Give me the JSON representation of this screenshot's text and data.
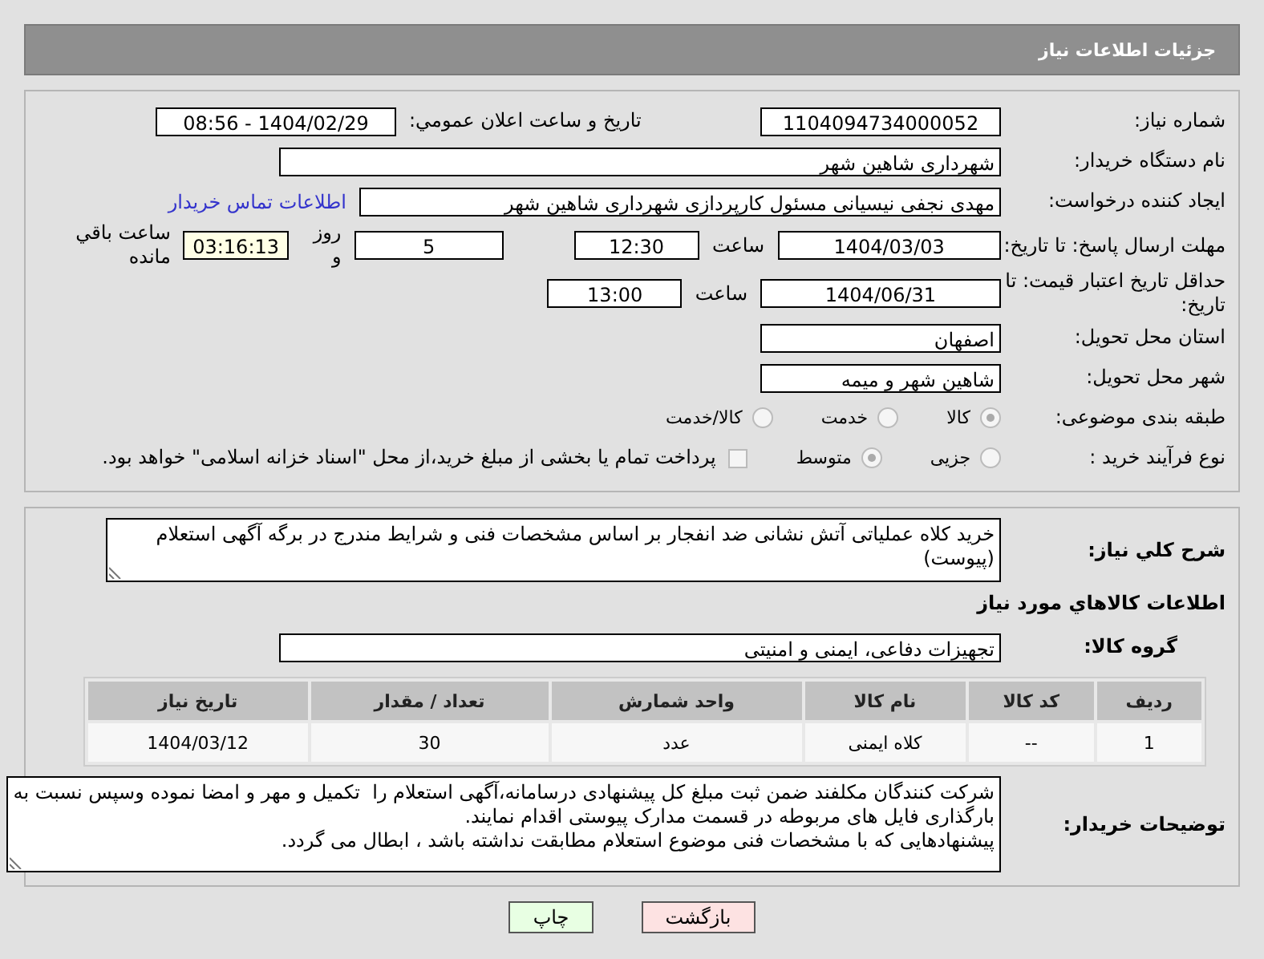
{
  "header": {
    "title": "جزئیات اطلاعات نیاز"
  },
  "need_number": {
    "label": "شماره نیاز:",
    "value": "1104094734000052"
  },
  "announce": {
    "label": "تاریخ و ساعت اعلان عمومي:",
    "value": "1404/02/29 - 08:56"
  },
  "buyer": {
    "label": "نام دستگاه خریدار:",
    "value": "شهرداری شاهین شهر"
  },
  "creator": {
    "label": "ایجاد کننده درخواست:",
    "value": "مهدی نجفی نیسیانی مسئول کارپردازی شهرداری شاهین شهر",
    "link": "اطلاعات تماس خریدار"
  },
  "deadline": {
    "label": "مهلت ارسال پاسخ: تا تاریخ:",
    "date": "1404/03/03",
    "time_label": "ساعت",
    "time": "12:30",
    "days": "5",
    "days_label": "روز و",
    "remaining": "03:16:13",
    "remaining_label": "ساعت باقي مانده"
  },
  "validity": {
    "label": "حداقل تاریخ اعتبار قیمت: تا تاریخ:",
    "date": "1404/06/31",
    "time_label": "ساعت",
    "time": "13:00"
  },
  "province": {
    "label": "استان محل تحویل:",
    "value": "اصفهان"
  },
  "city": {
    "label": "شهر محل تحویل:",
    "value": "شاهین شهر و میمه"
  },
  "category": {
    "label": "طبقه بندی موضوعی:",
    "options": [
      {
        "label": "کالا",
        "selected": true
      },
      {
        "label": "خدمت",
        "selected": false
      },
      {
        "label": "کالا/خدمت",
        "selected": false
      }
    ]
  },
  "process": {
    "label": "نوع فرآیند خرید :",
    "options": [
      {
        "label": "جزیی",
        "selected": false
      },
      {
        "label": "متوسط",
        "selected": true
      }
    ],
    "treasury": {
      "label": "پرداخت تمام یا بخشی از مبلغ خرید،از محل \"اسناد خزانه اسلامی\" خواهد بود.",
      "checked": false
    }
  },
  "description": {
    "label": "شرح کلي نیاز:",
    "value": "خرید کلاه عملیاتی آتش نشانی ضد انفجار بر اساس مشخصات فنی و شرایط مندرج در برگه آگهی استعلام (پیوست)"
  },
  "goods_heading": "اطلاعات کالاهاي مورد نیاز",
  "goods_group": {
    "label": "گروه کالا:",
    "value": "تجهیزات دفاعی، ایمنی و امنیتی"
  },
  "table": {
    "columns": [
      "ردیف",
      "کد کالا",
      "نام کالا",
      "واحد شمارش",
      "تعداد / مقدار",
      "تاریخ نیاز"
    ],
    "rows": [
      [
        "1",
        "--",
        "کلاه ایمنی",
        "عدد",
        "30",
        "1404/03/12"
      ]
    ]
  },
  "buyer_notes": {
    "label": "توضیحات خریدار:",
    "value": "شرکت کنندگان مکلفند ضمن ثبت مبلغ کل پیشنهادی درسامانه،آگهی استعلام را  تکمیل و مهر و امضا نموده وسپس نسبت به بارگذاری فایل های مربوطه در قسمت مدارک پیوستی اقدام نمایند.\nپیشنهادهایی که با مشخصات فنی موضوع استعلام مطابقت نداشته باشد ، ابطال می گردد."
  },
  "buttons": [
    {
      "kind": "back",
      "label": "بازگشت"
    },
    {
      "kind": "print",
      "label": "چاپ"
    }
  ]
}
